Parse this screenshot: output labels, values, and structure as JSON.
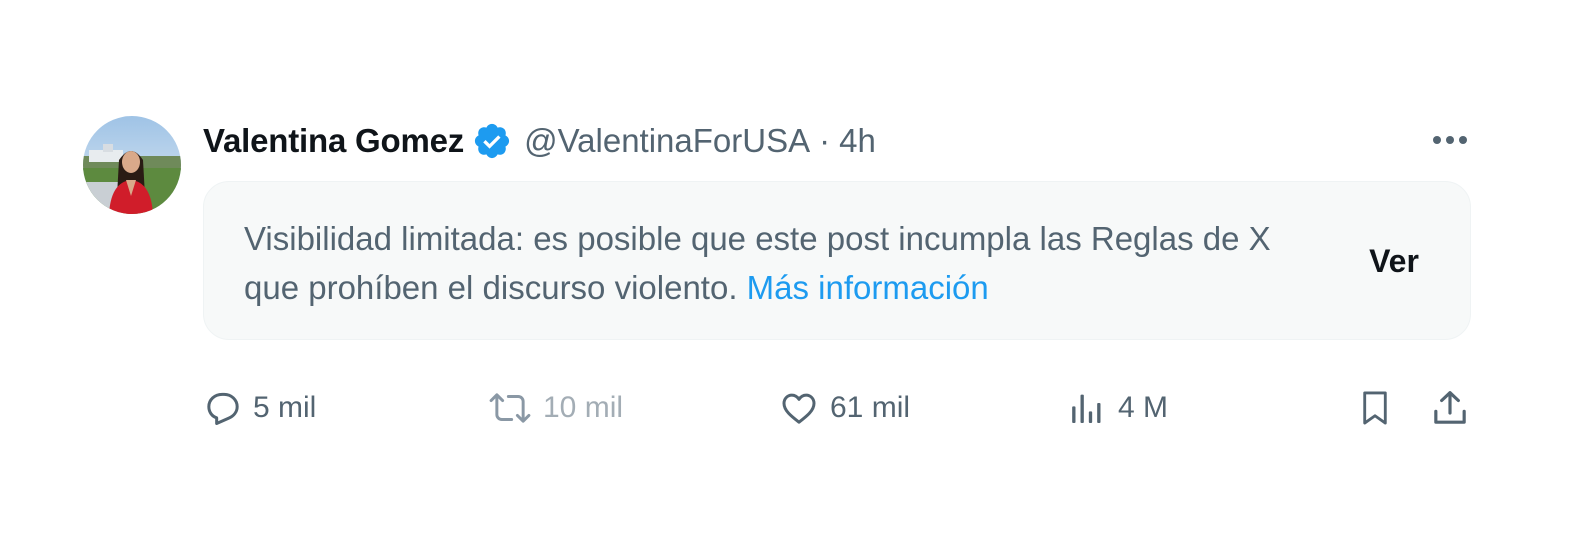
{
  "tweet": {
    "author": {
      "display_name": "Valentina Gomez",
      "verified_icon": "verified-badge-icon",
      "handle": "@ValentinaForUSA",
      "time": "4h"
    },
    "separator": "·",
    "more_icon": "more-dots-icon",
    "notice": {
      "text": "Visibilidad limitada: es posible que este post incumpla las Reglas de X que prohíben el discurso violento.",
      "link_label": "Más información",
      "view_label": "Ver"
    },
    "actions": {
      "reply_count": "5 mil",
      "repost_count": "10 mil",
      "like_count": "61 mil",
      "views_count": "4 M"
    }
  },
  "colors": {
    "accent": "#1d9bf0",
    "secondary_text": "#536471",
    "notice_bg": "#f7f9f9",
    "verified": "#1d9bf0"
  }
}
